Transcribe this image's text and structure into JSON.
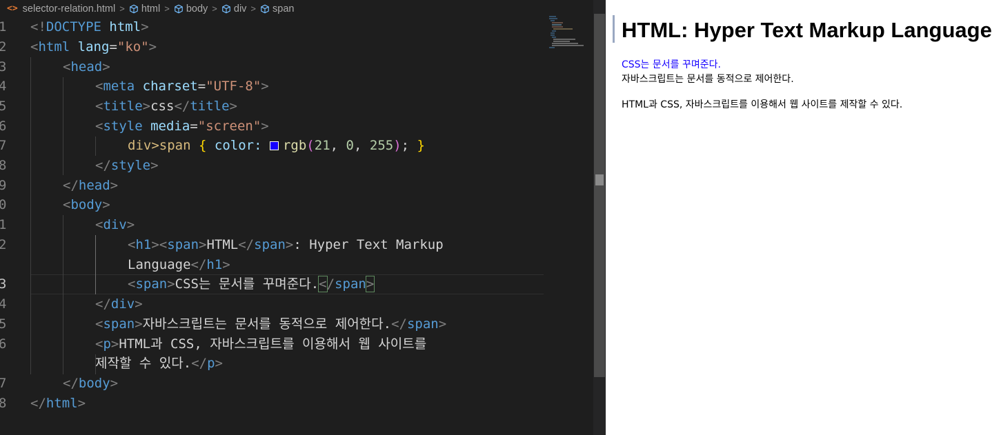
{
  "breadcrumb": {
    "file": "selector-relation.html",
    "items": [
      "html",
      "body",
      "div",
      "span"
    ]
  },
  "editor": {
    "line_numbers": [
      "1",
      "2",
      "3",
      "4",
      "5",
      "6",
      "7",
      "8",
      "9",
      "0",
      "1",
      "2",
      "3",
      "4",
      "5",
      "6",
      "7",
      "8"
    ],
    "code": {
      "doctype_open": "<!",
      "doctype_kw": "DOCTYPE",
      "doctype_html": "html",
      "doctype_close": ">",
      "html_tag": "html",
      "lang_attr": "lang",
      "lang_val": "\"ko\"",
      "head_tag": "head",
      "meta_tag": "meta",
      "charset_attr": "charset",
      "charset_val": "\"UTF-8\"",
      "title_tag": "title",
      "title_text": "css",
      "style_tag": "style",
      "media_attr": "media",
      "media_val": "\"screen\"",
      "selector": "div>span",
      "property": "color:",
      "rgb_fn": "rgb",
      "r": "21",
      "g": "0",
      "b": "255",
      "body_tag": "body",
      "div_tag": "div",
      "h1_tag": "h1",
      "span_tag": "span",
      "h1_span_text": "HTML",
      "h1_rest": ": Hyper Text Markup",
      "h1_wrap": "Language",
      "span1_text": "CSS는 문서를 꾸며준다.",
      "span2_text": "자바스크립트는 문서를 동적으로 제어한다.",
      "p_tag": "p",
      "p_text": "HTML과 CSS, 자바스크립트를 이용해서 웹 사이트를",
      "p_wrap": "제작할 수 있다."
    },
    "swatch_color": "#1500ff"
  },
  "preview": {
    "h1": "HTML: Hyper Text Markup Language",
    "span1": "CSS는 문서를 꾸며준다.",
    "span1_color": "#1500ff",
    "span2": "자바스크립트는 문서를 동적으로 제어한다.",
    "p": "HTML과 CSS, 자바스크립트를 이용해서 웹 사이트를 제작할 수 있다."
  }
}
